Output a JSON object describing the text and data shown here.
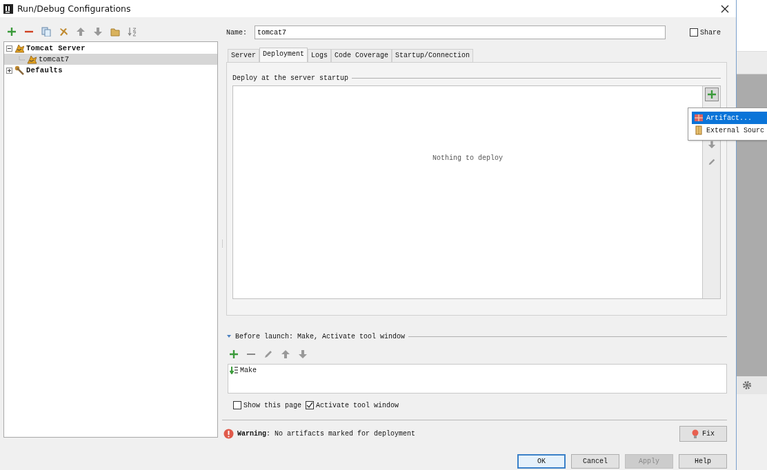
{
  "window": {
    "title": "Run/Debug Configurations"
  },
  "tree": [
    {
      "label": "Tomcat Server",
      "kind": "server",
      "expanded": true,
      "selected": false,
      "children": [
        {
          "label": "tomcat7",
          "kind": "server",
          "selected": true
        }
      ]
    },
    {
      "label": "Defaults",
      "kind": "defaults",
      "expanded": false,
      "selected": false
    }
  ],
  "name_field": {
    "label": "Name:",
    "value": "tomcat7"
  },
  "share": {
    "label": "Share",
    "checked": false
  },
  "tabs": [
    {
      "label": "Server",
      "selected": false
    },
    {
      "label": "Deployment",
      "selected": true
    },
    {
      "label": "Logs",
      "selected": false
    },
    {
      "label": "Code Coverage",
      "selected": false
    },
    {
      "label": "Startup/Connection",
      "selected": false
    }
  ],
  "deployment": {
    "group_title": "Deploy at the server startup",
    "empty_text": "Nothing to deploy"
  },
  "add_menu": [
    {
      "label": "Artifact...",
      "kind": "artifact",
      "selected": true
    },
    {
      "label": "External Sourc",
      "kind": "external",
      "selected": false
    }
  ],
  "before_launch": {
    "title": "Before launch: Make, Activate tool window",
    "expanded": true,
    "tasks": [
      {
        "label": "Make",
        "selected": false
      }
    ]
  },
  "options": [
    {
      "label": "Show this page",
      "checked": false
    },
    {
      "label": "Activate tool window",
      "checked": true
    }
  ],
  "warning": {
    "text": "**Warning**: No artifacts marked for deployment"
  },
  "fix_button": {
    "label": "Fix"
  },
  "buttons": [
    {
      "label": "OK",
      "default": true,
      "disabled": false
    },
    {
      "label": "Cancel",
      "default": false,
      "disabled": false
    },
    {
      "label": "Apply",
      "default": false,
      "disabled": true
    },
    {
      "label": "Help",
      "default": false,
      "disabled": false
    }
  ]
}
